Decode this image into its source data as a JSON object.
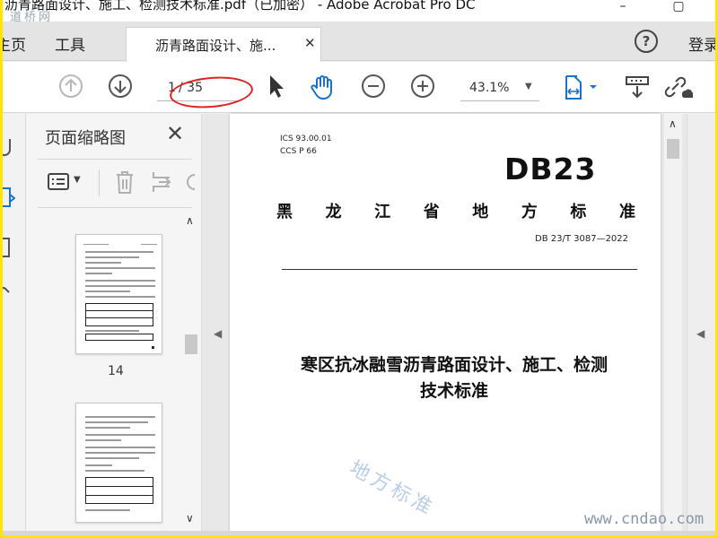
{
  "window": {
    "title": "沥青路面设计、施工、检测技术标准.pdf（已加密） - Adobe Acrobat Pro DC",
    "site_logo": "道桥网",
    "controls": [
      "–",
      "▢"
    ]
  },
  "tabs": {
    "home_label": "主页",
    "tools_label": "工具",
    "document_label": "沥青路面设计、施...",
    "close_glyph": "✕",
    "help_glyph": "?",
    "signin_label": "登录"
  },
  "toolbar": {
    "page_current": "1",
    "page_total": "/ 35",
    "zoom_value": "43.1%",
    "icons": [
      "prev-page-icon",
      "next-page-icon",
      "select-arrow-icon",
      "hand-tool-icon",
      "zoom-out-icon",
      "zoom-in-icon",
      "page-layout-icon",
      "scroll-mode-icon",
      "share-link-icon"
    ]
  },
  "sidebar": {
    "panel_title": "页面缩略图",
    "close_glyph": "✕",
    "thumbnails": [
      {
        "label": "14"
      },
      {
        "label": ""
      }
    ]
  },
  "document": {
    "ics_line": "ICS  93.00.01",
    "ccs_line": "CCS  P 66",
    "logo_text": "DB23",
    "org_chars": [
      "黑",
      "龙",
      "江",
      "省",
      "地",
      "方",
      "标",
      "准"
    ],
    "standard_no": "DB 23/T  3087—2022",
    "title_line1": "寒区抗冰融雪沥青路面设计、施工、检测",
    "title_line2": "技术标准",
    "stamp_text": "地方标准"
  },
  "watermark": {
    "text": "www.cndao.com"
  },
  "colors": {
    "annotation_red": "#e02020",
    "frame_yellow": "#ffe600",
    "accent_blue": "#1a73c8"
  }
}
